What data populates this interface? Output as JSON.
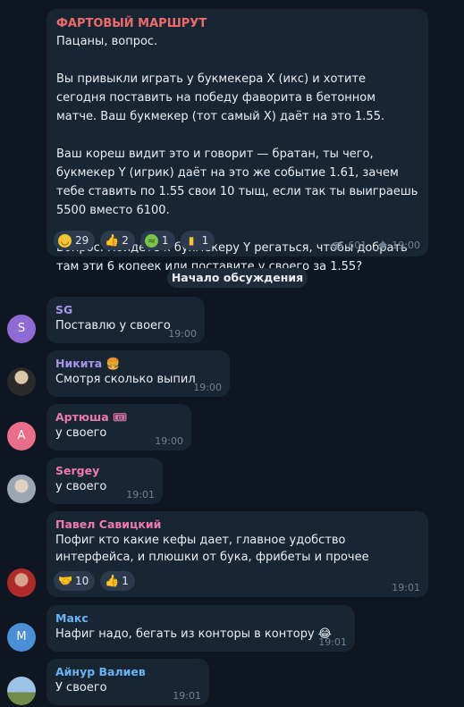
{
  "post": {
    "channel": "ФАРТОВЫЙ МАРШРУТ",
    "paragraphs": [
      "Пацаны, вопрос.",
      "Вы привыкли играть у букмекера Х (икс) и хотите сегодня поставить на победу фаворита в бетонном матче. Ваш букмекер (тот самый Х) даёт на это 1.55.",
      "Ваш кореш видит это и говорит — братан, ты чего, букмекер Y (игрик) даёт на это же событие 1.61, зачем тебе ставить по 1.55 свои 10 тыщ, если так ты выиграешь 5500 вместо 6100.",
      "Вопрос. Пойдёте к букмекеру Y регаться, чтобы добрать там эти 6 копеек или поставите у своего за 1.55?"
    ],
    "reactions": [
      {
        "emoji": "grinning-face",
        "count": "29"
      },
      {
        "emoji": "thumbs-up",
        "count": "2"
      },
      {
        "emoji": "nauseated-face",
        "count": "1"
      },
      {
        "emoji": "middle-finger",
        "count": "1"
      }
    ],
    "views": "601",
    "time": "19:00"
  },
  "divider": "Начало обсуждения",
  "messages": [
    {
      "name": "SG",
      "name_color": "#a695e7",
      "text": "Поставлю у своего",
      "time": "19:00",
      "avatar": "S",
      "avatar_color": "#8e6bd4"
    },
    {
      "name": "Никита 🍔",
      "name_color": "#a695e7",
      "text": "Смотря сколько выпил",
      "time": "19:00",
      "avatar": ""
    },
    {
      "name": "Артюша 🎟",
      "name_color": "#ee7aae",
      "text": "у своего",
      "time": "19:00",
      "avatar": "А",
      "avatar_color": "#e86e8a"
    },
    {
      "name": "Sergey",
      "name_color": "#ee7aae",
      "text": "у своего",
      "time": "19:01",
      "avatar": ""
    },
    {
      "name": "Павел Савицкий",
      "name_color": "#ee7aae",
      "text": "Пофиг кто какие кефы дает, главное удобство интерфейса, и плюшки от бука, фрибеты и прочее",
      "time": "19:01",
      "avatar": "",
      "reactions": [
        {
          "emoji": "handshake",
          "count": "10"
        },
        {
          "emoji": "thumbs-up",
          "count": "1"
        }
      ]
    },
    {
      "name": "Макс",
      "name_color": "#6ab3f3",
      "text": "Нафиг надо, бегать из конторы в контору 😂",
      "time": "19:01",
      "avatar": "М",
      "avatar_color": "#4a8fd8"
    },
    {
      "name": "Айнур Валиев",
      "name_color": "#6ab3f3",
      "text": "У своего",
      "time": "19:01",
      "avatar": ""
    }
  ]
}
